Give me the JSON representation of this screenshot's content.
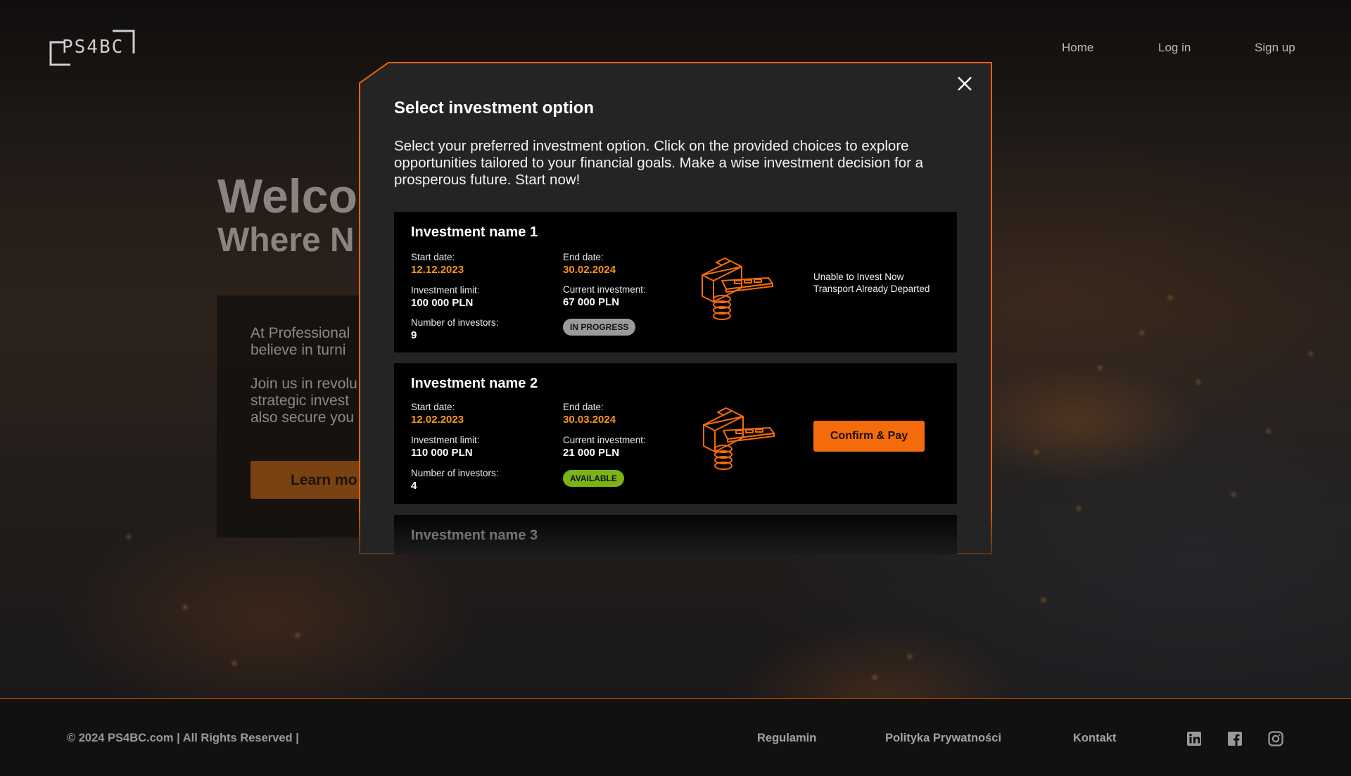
{
  "header": {
    "logo_text": "PS4BC",
    "nav": [
      {
        "label": "Home"
      },
      {
        "label": "Log in"
      },
      {
        "label": "Sign up"
      }
    ]
  },
  "hero": {
    "title": "Welco",
    "subtitle": "Where N",
    "paragraph_1": [
      "At Professional",
      "believe in turni"
    ],
    "paragraph_2": [
      "Join us in revolu",
      "strategic invest",
      "also secure you"
    ],
    "button_label": "Learn mo"
  },
  "modal": {
    "title": "Select investment option",
    "description": "Select your preferred investment option. Click on the provided choices to explore opportunities tailored to your financial goals. Make a wise investment decision for a prosperous future. Start now!",
    "investments": [
      {
        "name": "Investment name 1",
        "start_label": "Start date:",
        "start_date": "12.12.2023",
        "end_label": "End date:",
        "end_date": "30.02.2024",
        "limit_label": "Investment limit:",
        "limit": "100 000 PLN",
        "current_label": "Current investment:",
        "current": "67 000 PLN",
        "investors_label": "Number of investors:",
        "investors": "9",
        "status": "IN PROGRESS",
        "status_color": "#9a9a9a",
        "note": "Unable to Invest Now Transport Already Departed",
        "icon": "briefcase-coins-icon"
      },
      {
        "name": "Investment name 2",
        "start_label": "Start date:",
        "start_date": "12.02.2023",
        "end_label": "End date:",
        "end_date": "30.03.2024",
        "limit_label": "Investment limit:",
        "limit": "110 000 PLN",
        "current_label": "Current investment:",
        "current": "21 000 PLN",
        "investors_label": "Number of investors:",
        "investors": "4",
        "status": "AVAILABLE",
        "status_color": "#7bb21a",
        "action_label": "Confirm & Pay",
        "icon": "briefcase-coins-icon"
      },
      {
        "name": "Investment name 3"
      }
    ],
    "close_icon": "close-icon"
  },
  "footer": {
    "copyright": "© 2024 PS4BC.com | All Rights Reserved |",
    "links": [
      {
        "label": "Regulamin"
      },
      {
        "label": "Polityka Prywatności"
      },
      {
        "label": "Kontakt"
      }
    ],
    "social_icons": [
      "linkedin-icon",
      "facebook-icon",
      "instagram-icon"
    ]
  },
  "colors": {
    "accent": "#f36b0a",
    "date_orange": "#f7931e",
    "modal_bg": "#242424",
    "card_bg": "#000000",
    "border": "#e8620c"
  }
}
